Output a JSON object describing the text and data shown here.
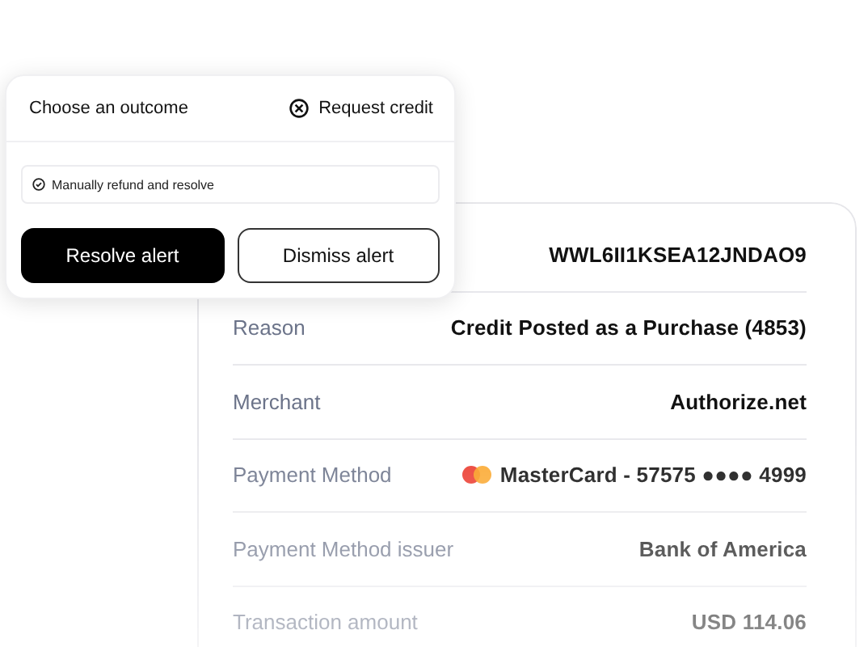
{
  "popup": {
    "title": "Choose an outcome",
    "action": "Request credit",
    "field": {
      "value": "Manually refund and resolve"
    },
    "buttons": [
      {
        "label": "Resolve alert",
        "kind": "primary"
      },
      {
        "label": "Dismiss alert",
        "kind": "secondary"
      }
    ]
  },
  "details": [
    {
      "value": "WWL6II1KSEA12JNDAO9"
    },
    {
      "label": "Reason",
      "value": "Credit Posted as a Purchase (4853)"
    },
    {
      "label": "Merchant",
      "value": "Authorize.net"
    },
    {
      "label": "Payment Method",
      "value": "MasterCard - 57575 ●●●● 4999",
      "kind": "card"
    },
    {
      "label": "Payment Method issuer",
      "value": "Bank of America"
    },
    {
      "label": "Transaction amount",
      "value": "USD 114.06"
    }
  ]
}
